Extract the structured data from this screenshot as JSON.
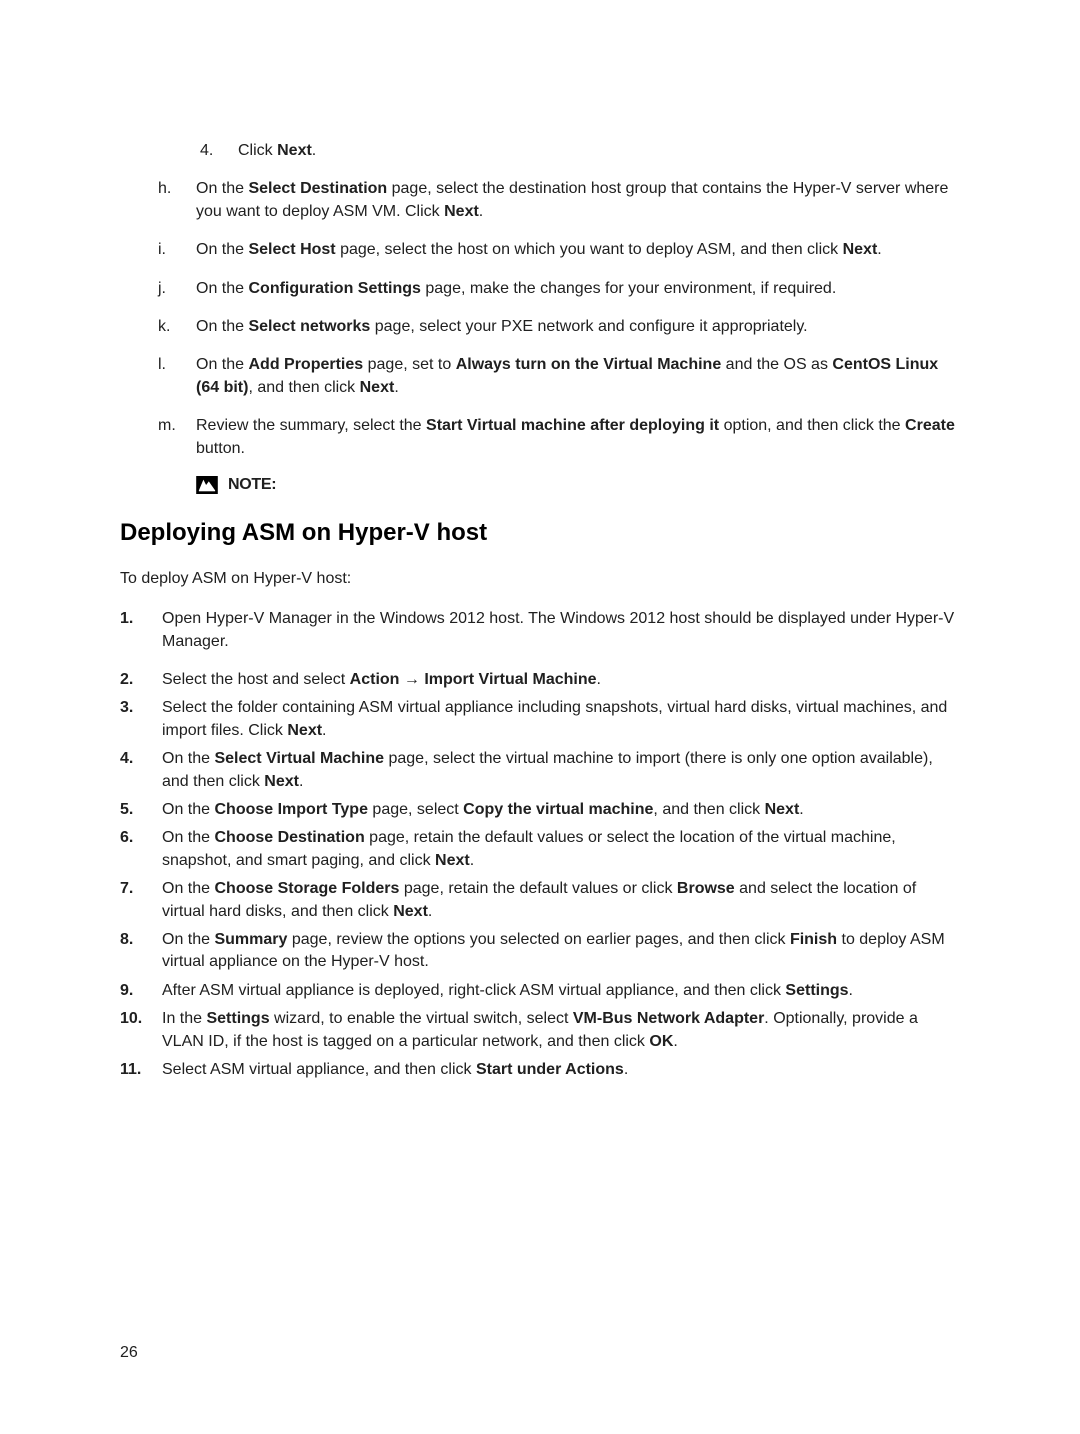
{
  "continued_list": {
    "level2_marker": "4.",
    "level2_body": "Click Next.",
    "items": [
      {
        "marker": "h.",
        "body": "On the Select Destination page, select the destination host group that contains the Hyper-V server where you want to deploy ASM VM. Click Next."
      },
      {
        "marker": "i.",
        "body": "On the Select Host page, select the host on which you want to deploy ASM, and then click Next."
      },
      {
        "marker": "j.",
        "body": "On the Configuration Settings page, make the changes for your environment, if required."
      },
      {
        "marker": "k.",
        "body": "On the Select networks page, select your PXE network and configure it appropriately."
      },
      {
        "marker": "l.",
        "body": "On the Add Properties page, set to Always turn on the Virtual Machine and the OS as CentOS Linux (64 bit), and then click Next."
      },
      {
        "marker": "m.",
        "body": "Review the summary, select the Start Virtual machine after deploying it option, and then click the Create button."
      }
    ],
    "note_label": "NOTE:"
  },
  "heading": "Deploying ASM on Hyper-V host",
  "intro": "To deploy ASM on Hyper-V host:",
  "steps": [
    {
      "marker": "1.",
      "body": "Open Hyper-V Manager in the Windows 2012 host. The Windows 2012 host should be displayed under Hyper-V Manager."
    },
    {
      "marker": "2.",
      "body": "Select the host and select Action → Import Virtual Machine."
    },
    {
      "marker": "3.",
      "body": "Select the folder containing ASM virtual appliance including snapshots, virtual hard disks, virtual machines, and import files. Click Next."
    },
    {
      "marker": "4.",
      "body": "On the Select Virtual Machine page, select the virtual machine to import (there is only one option available), and then click Next."
    },
    {
      "marker": "5.",
      "body": "On the Choose Import Type page, select Copy the virtual machine, and then click Next."
    },
    {
      "marker": "6.",
      "body": "On the Choose Destination page, retain the default values or select the location of the virtual machine, snapshot, and smart paging, and click Next."
    },
    {
      "marker": "7.",
      "body": "On the Choose Storage Folders page, retain the default values or click Browse and select the location of virtual hard disks, and then click Next."
    },
    {
      "marker": "8.",
      "body": "On the Summary page, review the options you selected on earlier pages, and then click Finish to deploy ASM virtual appliance on the Hyper-V host."
    },
    {
      "marker": "9.",
      "body": "After ASM virtual appliance is deployed, right-click ASM virtual appliance, and then click Settings."
    },
    {
      "marker": "10.",
      "body": "In the Settings wizard, to enable the virtual switch, select VM-Bus Network Adapter. Optionally, provide a VLAN ID, if the host is tagged on a particular network, and then click OK."
    },
    {
      "marker": "11.",
      "body": "Select ASM virtual appliance, and then click Start under Actions."
    }
  ],
  "bold_phrases": [
    "Next",
    "Select Destination",
    "Select Host",
    "Configuration Settings",
    "Select networks",
    "Add Properties",
    "Always turn on the Virtual Machine",
    "CentOS Linux (64 bit)",
    "Start Virtual machine after deploying it",
    "Create",
    "Action → Import Virtual Machine",
    "Select Virtual Machine",
    "Choose Import Type",
    "Copy the virtual machine",
    "Choose Destination",
    "Choose Storage Folders",
    "Browse",
    "Summary",
    "Finish",
    "Settings",
    "VM-Bus Network Adapter",
    "OK",
    "Start under Actions"
  ],
  "page_number": "26"
}
